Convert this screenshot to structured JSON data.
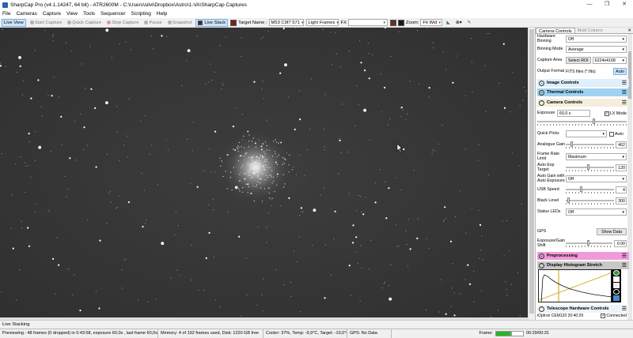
{
  "window": {
    "title": "SharpCap Pro (v4.1.14247, 64 bit) - ATR2600M - C:\\Users\\silvi\\Dropbox\\Astro\\1-VA\\SharpCap Captures",
    "controls": [
      "—",
      "❐",
      "✕"
    ]
  },
  "menu": [
    "File",
    "Cameras",
    "Capture",
    "View",
    "Tools",
    "Sequencer",
    "Scripting",
    "Help"
  ],
  "toolbar": {
    "live_view": "Live View",
    "start_capture": "Start Capture",
    "quick_capture": "Quick Capture",
    "stop_capture": "Stop Capture",
    "pause": "Pause",
    "snapshot": "Snapshot",
    "live_stack": "Live Stack",
    "target_label": "Target Name :",
    "target_value": "M53 C9f7 571",
    "frame_type": "Light Frames",
    "fx_label": "FX",
    "fx_value": "",
    "zoom_label": "Zoom:",
    "zoom_value": "Fit Wid"
  },
  "panel": {
    "tabs": [
      "Camera Controls",
      "Multi Column"
    ],
    "hardware_binning_label": "Hardware Binning",
    "hardware_binning_value": "Off",
    "binning_mode_label": "Binning Mode",
    "binning_mode_value": "Average",
    "capture_area_label": "Capture Area",
    "select_roi": "Select ROI",
    "capture_area_value": "6224x4168",
    "output_format_label": "Output Format",
    "output_format_value": "FITS files (*.fits)",
    "auto_button": "Auto",
    "sections": {
      "image_controls": "Image Controls",
      "thermal_controls": "Thermal Controls",
      "camera_controls": "Camera Controls",
      "preprocessing": "Preprocessing",
      "histogram": "Display Histogram Stretch",
      "telescope": "Telescope Hardware Controls"
    },
    "exposure_label": "Exposure",
    "exposure_value": "60,0 s",
    "lx_mode": "LX Mode",
    "quick_picks_label": "Quick Picks",
    "quick_picks_auto": "Auto",
    "analogue_gain_label": "Analogue Gain",
    "analogue_gain_value": "462",
    "frame_rate_label": "Frame Rate Limit",
    "frame_rate_value": "Maximum",
    "auto_exp_label": "Auto Exp Target",
    "auto_exp_value": "120",
    "auto_gain_label": "Auto Gain with Auto Exposure",
    "auto_gain_value": "Off",
    "usb_speed_label": "USB Speed",
    "usb_speed_value": "4",
    "black_level_label": "Black Level",
    "black_level_value": "300",
    "status_leds_label": "Status LEDs",
    "status_leds_value": "Off",
    "gps_label": "GPS",
    "show_data": "Show Data",
    "exp_gain_shift_label": "Exposure/Gain Shift",
    "exp_gain_shift_value": "0.00",
    "telescope_device": "iOptron CEM120 20:40:29",
    "connected": "Connected"
  },
  "status_strip": "Live Stacking",
  "status": {
    "previewing": "Previewing : 48 frames (0 dropped) in 0:43:58, exposure 60,0s , last frame 60,0s",
    "memory": "Memory: 4 of 192 frames used, Disk: 1220 GB free",
    "cooler": "Cooler: 37%, Temp: -9,9°C, Target: -10,0°C",
    "gps": "GPS: No Data",
    "frame_label": "Frame:",
    "time": "00:29/00:31"
  },
  "colors": {
    "thermal": "#9fd1f0",
    "preprocessing": "#f29ad9",
    "histogram": "#c8c8c8",
    "camera": "#f6eddc",
    "image": "#dfeffb",
    "telescope": "#eef3fa"
  }
}
